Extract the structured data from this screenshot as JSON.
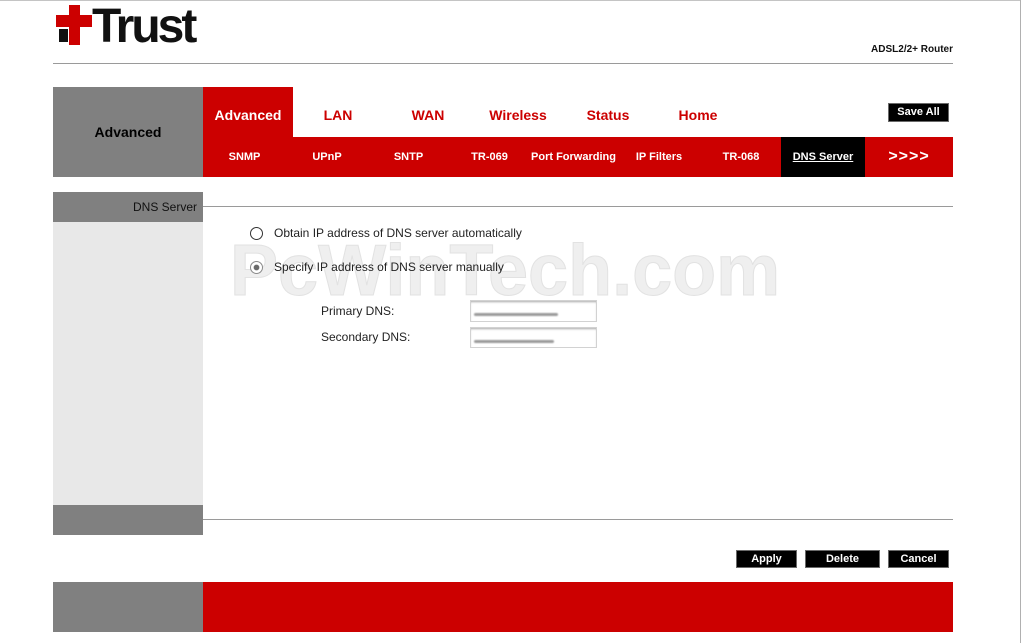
{
  "brand": {
    "logo_text": "Trust",
    "logo_icon": "trust-cross-icon",
    "product": "ADSL2/2+ Router"
  },
  "header": {
    "section_title": "Advanced",
    "tabs": [
      {
        "label": "Advanced",
        "active": true
      },
      {
        "label": "LAN",
        "active": false
      },
      {
        "label": "WAN",
        "active": false
      },
      {
        "label": "Wireless",
        "active": false
      },
      {
        "label": "Status",
        "active": false
      },
      {
        "label": "Home",
        "active": false
      }
    ],
    "save_all_label": "Save All"
  },
  "subnav": {
    "items": [
      {
        "label": "SNMP",
        "active": false
      },
      {
        "label": "UPnP",
        "active": false
      },
      {
        "label": "SNTP",
        "active": false
      },
      {
        "label": "TR-069",
        "active": false
      },
      {
        "label": "Port Forwarding",
        "active": false
      },
      {
        "label": "IP Filters",
        "active": false
      },
      {
        "label": "TR-068",
        "active": false
      },
      {
        "label": "DNS Server",
        "active": true
      }
    ],
    "more_label": ">>>>"
  },
  "sidebar": {
    "title": "DNS Server"
  },
  "form": {
    "dns_mode_options": [
      {
        "label": "Obtain IP address of DNS server automatically",
        "selected": false
      },
      {
        "label": "Specify IP address of DNS server manually",
        "selected": true
      }
    ],
    "primary_dns": {
      "label": "Primary DNS:",
      "value": ""
    },
    "secondary_dns": {
      "label": "Secondary DNS:",
      "value": ""
    }
  },
  "actions": {
    "apply_label": "Apply",
    "delete_label": "Delete",
    "cancel_label": "Cancel"
  },
  "watermark": "PcWinTech.com",
  "colors": {
    "brand_red": "#cc0000",
    "dark_gray": "#808080",
    "light_gray": "#e8e8e8",
    "black": "#000000"
  }
}
